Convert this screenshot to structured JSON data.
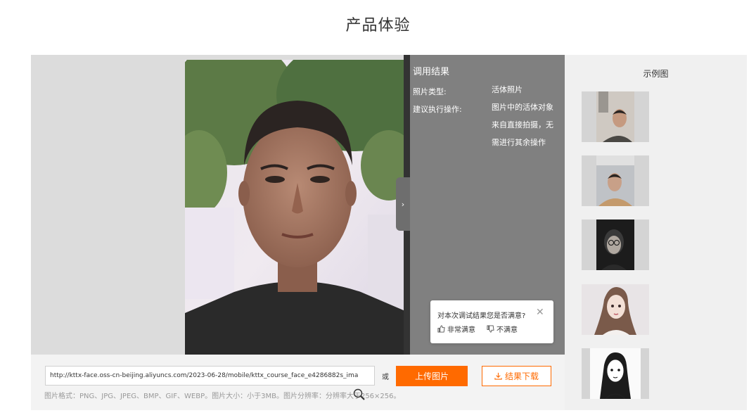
{
  "page_title": "产品体验",
  "result": {
    "title": "调用结果",
    "rows": [
      {
        "label": "照片类型:",
        "value_lines": [
          "活体照片"
        ]
      },
      {
        "label": "建议执行操作:",
        "value_lines": [
          "图片中的活体对象",
          "来自直接拍摄，无",
          "需进行其余操作"
        ]
      }
    ]
  },
  "toggle": {
    "glyph": "›"
  },
  "feedback": {
    "question": "对本次调试结果您是否满意?",
    "close_glyph": "✕",
    "satisfied_label": "非常满意",
    "unsatisfied_label": "不满意"
  },
  "input": {
    "url_value": "http://kttx-face.oss-cn-beijing.aliyuncs.com/2023-06-28/mobile/kttx_course_face_e4286882s_ima"
  },
  "or_text": "或",
  "buttons": {
    "upload": "上传图片",
    "download": "结果下载"
  },
  "hint": "图片格式：PNG、JPG、JPEG、BMP、GIF、WEBP。图片大小：小于3MB。图片分辨率：分辨率大于256×256。",
  "samples": {
    "title": "示例图",
    "items": [
      {
        "name": "sample-man-office-1"
      },
      {
        "name": "sample-man-office-2"
      },
      {
        "name": "sample-woman-dark"
      },
      {
        "name": "sample-illustrated-woman-color"
      },
      {
        "name": "sample-illustrated-woman-sketch"
      }
    ]
  },
  "colors": {
    "accent": "#ff6a00",
    "result_panel": "#808080",
    "left_bg": "#dcdcdc"
  },
  "icons": {
    "thumbs_up": "thumbs-up-icon",
    "thumbs_down": "thumbs-down-icon",
    "download": "download-icon",
    "close": "close-icon",
    "chevron": "chevron-right-icon",
    "cursor": "magnifier-cursor-icon"
  }
}
